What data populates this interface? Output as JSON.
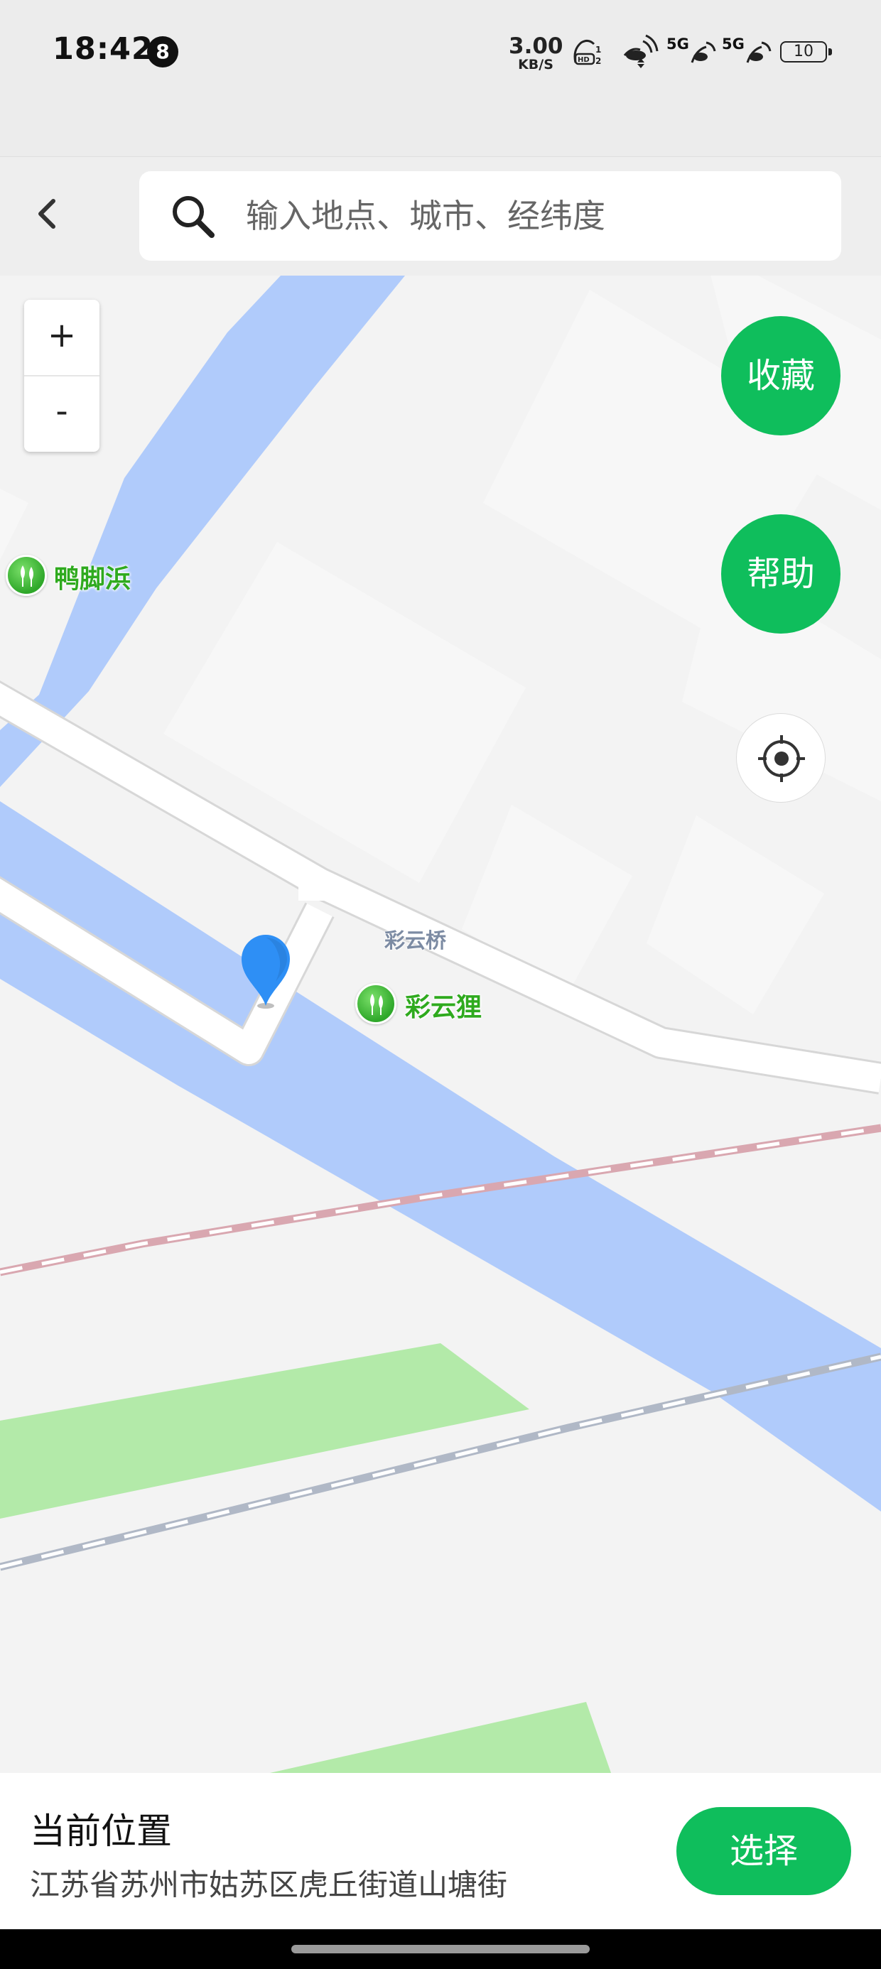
{
  "status_bar": {
    "time": "18:42",
    "notification_count": "8",
    "net_speed_value": "3.00",
    "net_speed_unit": "KB/S",
    "signal1_label": "5G",
    "signal2_label": "5G",
    "battery_level": "10",
    "icons": [
      "hd-voice-icon",
      "wifi-icon",
      "signal-icon",
      "signal-icon",
      "battery-icon"
    ]
  },
  "search": {
    "placeholder": "输入地点、城市、经纬度"
  },
  "map": {
    "zoom_in_label": "+",
    "zoom_out_label": "-",
    "favorite_label": "收藏",
    "help_label": "帮助",
    "pois": [
      {
        "name": "鸭脚浜",
        "icon": "park-icon"
      },
      {
        "name": "彩云狸",
        "icon": "park-icon"
      }
    ],
    "road_labels": [
      "彩云桥"
    ],
    "colors": {
      "land": "#f3f3f3",
      "water": "#b0cbfb",
      "road": "#ffffff",
      "green_area": "#b3eaa9",
      "railway_red": "#e2b5bd",
      "railway_gray": "#b7bfcc",
      "accent": "#0fbe5c",
      "pin": "#2e8ff5"
    }
  },
  "bottom_sheet": {
    "title": "当前位置",
    "address": "江苏省苏州市姑苏区虎丘街道山塘街",
    "select_label": "选择"
  }
}
